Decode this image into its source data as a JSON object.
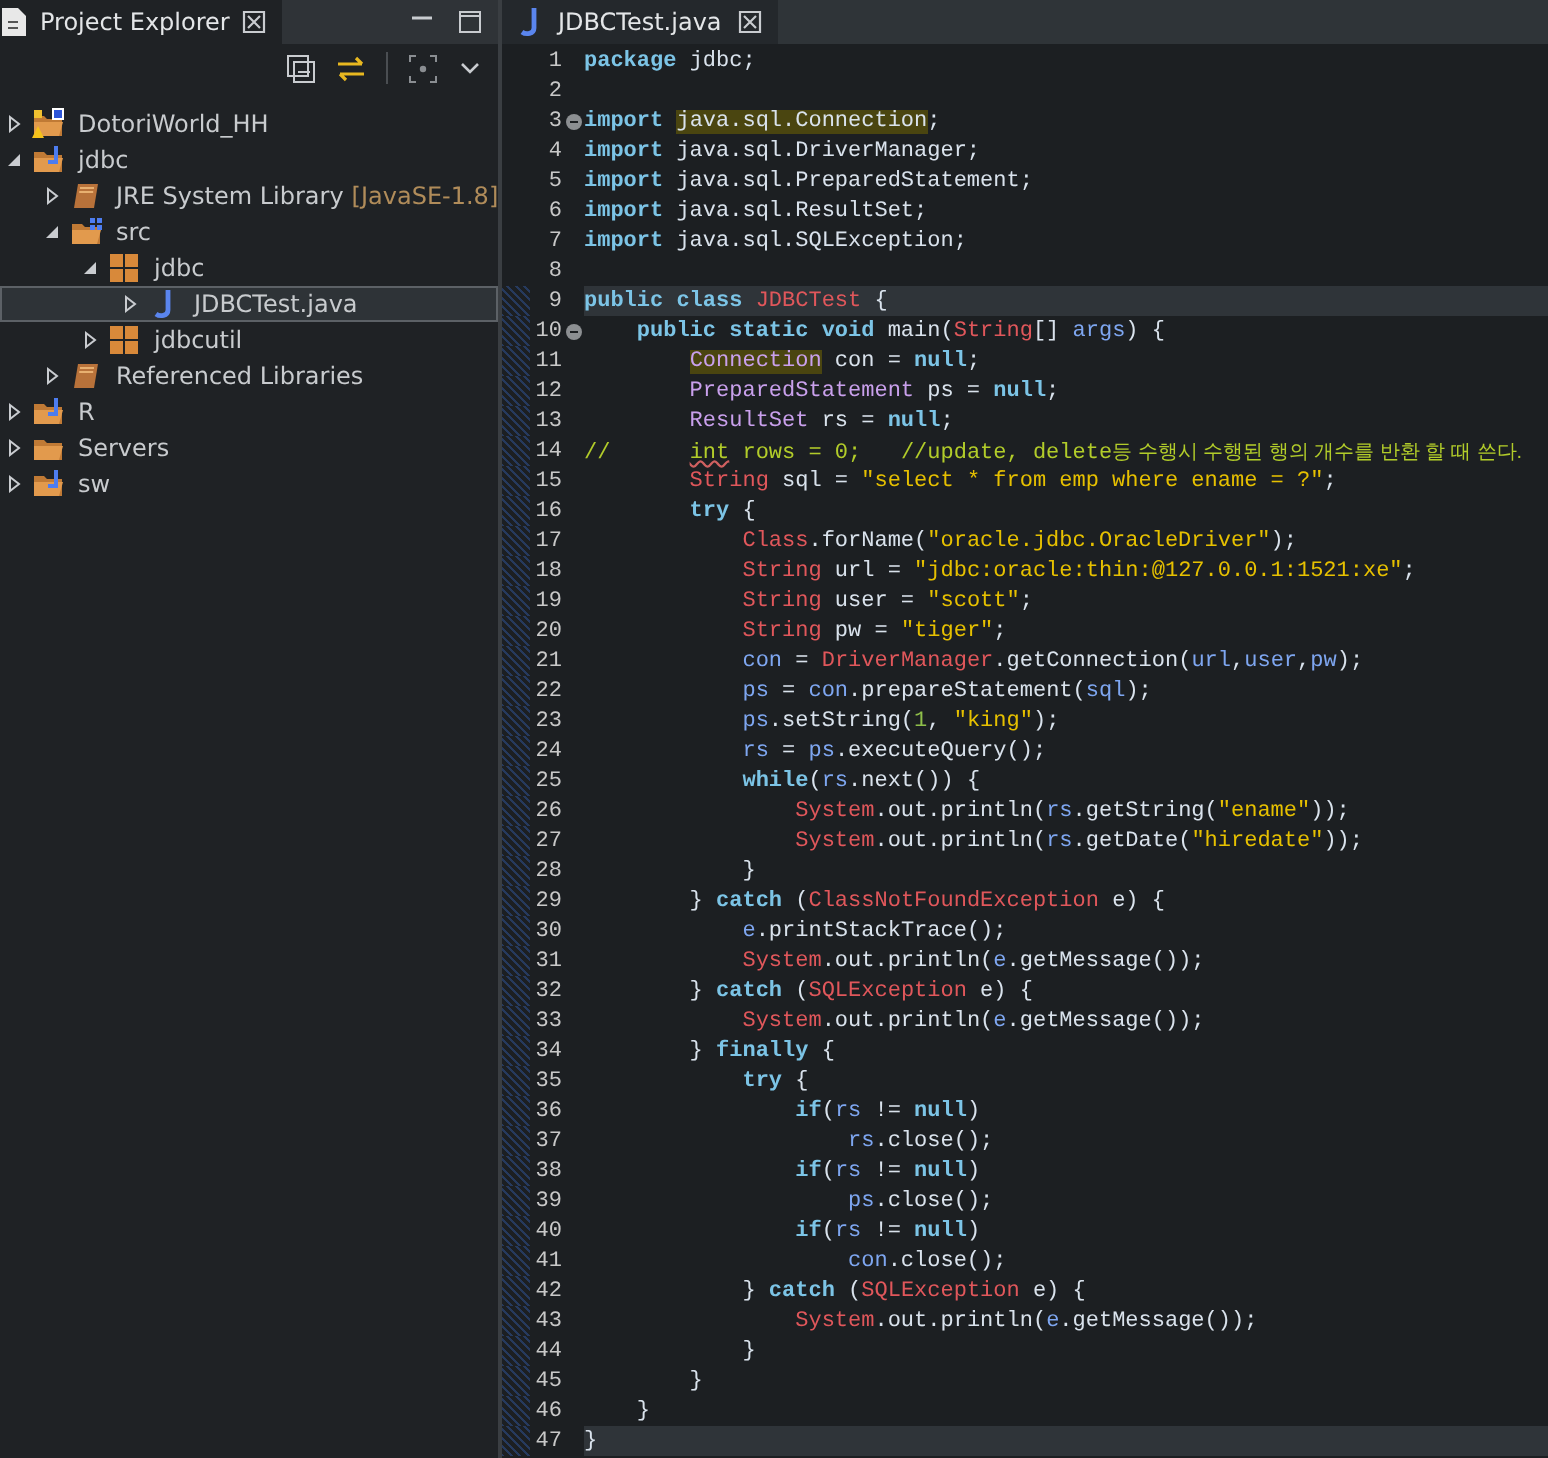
{
  "explorer": {
    "title": "Project Explorer",
    "tree": [
      {
        "label": "DotoriWorld_HH",
        "kind": "project-warning",
        "expanded": false,
        "selected": false
      },
      {
        "label": "jdbc",
        "kind": "project",
        "expanded": true,
        "selected": false,
        "children": [
          {
            "label": "JRE System Library",
            "decoration": "[JavaSE-1.8]",
            "kind": "library",
            "expanded": false,
            "selected": false
          },
          {
            "label": "src",
            "kind": "source-folder",
            "expanded": true,
            "selected": false,
            "children": [
              {
                "label": "jdbc",
                "kind": "package",
                "expanded": true,
                "selected": false,
                "children": [
                  {
                    "label": "JDBCTest.java",
                    "kind": "java-file",
                    "expanded": false,
                    "selected": true
                  }
                ]
              },
              {
                "label": "jdbcutil",
                "kind": "package",
                "expanded": false,
                "selected": false
              }
            ]
          },
          {
            "label": "Referenced Libraries",
            "kind": "library",
            "expanded": false,
            "selected": false
          }
        ]
      },
      {
        "label": "R",
        "kind": "project",
        "expanded": false,
        "selected": false
      },
      {
        "label": "Servers",
        "kind": "folder",
        "expanded": false,
        "selected": false
      },
      {
        "label": "sw",
        "kind": "project",
        "expanded": false,
        "selected": false
      }
    ]
  },
  "editor": {
    "tab": {
      "title": "JDBCTest.java"
    },
    "lines": [
      {
        "number": "1",
        "highlighted": false,
        "fold": false,
        "tokens": [
          {
            "kind": "keyword",
            "text": "package"
          },
          {
            "kind": "plain",
            "text": " jdbc;"
          }
        ]
      },
      {
        "number": "2",
        "highlighted": false,
        "fold": false
      },
      {
        "number": "3",
        "highlighted": false,
        "fold": true,
        "tokens": [
          {
            "kind": "keyword",
            "text": "import "
          },
          {
            "kind": "plain",
            "text": "java.sql.Connection",
            "occurrence": true
          },
          {
            "kind": "plain",
            "text": ";"
          }
        ]
      },
      {
        "number": "4",
        "highlighted": false,
        "fold": false,
        "tokens": [
          {
            "kind": "keyword",
            "text": "import"
          },
          {
            "kind": "plain",
            "text": " java.sql.DriverManager;"
          }
        ]
      },
      {
        "number": "5",
        "highlighted": false,
        "fold": false,
        "tokens": [
          {
            "kind": "keyword",
            "text": "import"
          },
          {
            "kind": "plain",
            "text": " java.sql.PreparedStatement;"
          }
        ]
      },
      {
        "number": "6",
        "highlighted": false,
        "fold": false,
        "tokens": [
          {
            "kind": "keyword",
            "text": "import"
          },
          {
            "kind": "plain",
            "text": " java.sql.ResultSet;"
          }
        ]
      },
      {
        "number": "7",
        "highlighted": false,
        "fold": false,
        "tokens": [
          {
            "kind": "keyword",
            "text": "import"
          },
          {
            "kind": "plain",
            "text": " java.sql.SQLException;"
          }
        ]
      },
      {
        "number": "8",
        "highlighted": false,
        "fold": false
      },
      {
        "number": "9",
        "highlighted": true,
        "fold": false,
        "tokens": [
          {
            "kind": "keyword",
            "text": "public class "
          },
          {
            "kind": "class",
            "text": "JDBCTest"
          },
          {
            "kind": "plain",
            "text": " {"
          }
        ]
      },
      {
        "number": "10",
        "highlighted": false,
        "fold": true,
        "tokens": [
          {
            "kind": "keyword",
            "text": "    public static void"
          },
          {
            "kind": "plain",
            "text": " main("
          },
          {
            "kind": "class",
            "text": "String"
          },
          {
            "kind": "plain",
            "text": "[] "
          },
          {
            "kind": "variable",
            "text": "args"
          },
          {
            "kind": "plain",
            "text": ") {"
          }
        ]
      },
      {
        "number": "11",
        "highlighted": false,
        "fold": false,
        "tokens": [
          {
            "kind": "type",
            "text": "        Connection",
            "occurrence": true
          },
          {
            "kind": "plain",
            "text": " con = "
          },
          {
            "kind": "keyword",
            "text": "null"
          },
          {
            "kind": "plain",
            "text": ";"
          }
        ]
      },
      {
        "number": "12",
        "highlighted": false,
        "fold": false,
        "tokens": [
          {
            "kind": "type",
            "text": "        PreparedStatement"
          },
          {
            "kind": "plain",
            "text": " ps = "
          },
          {
            "kind": "keyword",
            "text": "null"
          },
          {
            "kind": "plain",
            "text": ";"
          }
        ]
      },
      {
        "number": "13",
        "highlighted": false,
        "fold": false,
        "tokens": [
          {
            "kind": "type",
            "text": "        ResultSet"
          },
          {
            "kind": "plain",
            "text": " rs = "
          },
          {
            "kind": "keyword",
            "text": "null"
          },
          {
            "kind": "plain",
            "text": ";"
          }
        ]
      },
      {
        "number": "14",
        "highlighted": false,
        "fold": false,
        "tokens": [
          {
            "kind": "comment",
            "text": "//      "
          },
          {
            "kind": "comment",
            "text": "int",
            "warning": true
          },
          {
            "kind": "comment",
            "text": " rows = 0;   //update, delete"
          },
          {
            "kind": "comment",
            "text": "등 수행시 수행된 행의 개수를 반환 할 때 쓴다."
          }
        ]
      },
      {
        "number": "15",
        "highlighted": false,
        "fold": false,
        "tokens": [
          {
            "kind": "class",
            "text": "        String"
          },
          {
            "kind": "plain",
            "text": " sql = "
          },
          {
            "kind": "string",
            "text": "\"select * from emp where ename = ?\""
          },
          {
            "kind": "plain",
            "text": ";"
          }
        ]
      },
      {
        "number": "16",
        "highlighted": false,
        "fold": false,
        "tokens": [
          {
            "kind": "keyword",
            "text": "        try"
          },
          {
            "kind": "plain",
            "text": " {"
          }
        ]
      },
      {
        "number": "17",
        "highlighted": false,
        "fold": false,
        "tokens": [
          {
            "kind": "class",
            "text": "            Class"
          },
          {
            "kind": "plain",
            "text": ".forName("
          },
          {
            "kind": "string",
            "text": "\"oracle.jdbc.OracleDriver\""
          },
          {
            "kind": "plain",
            "text": ");"
          }
        ]
      },
      {
        "number": "18",
        "highlighted": false,
        "fold": false,
        "tokens": [
          {
            "kind": "class",
            "text": "            String"
          },
          {
            "kind": "plain",
            "text": " url = "
          },
          {
            "kind": "string",
            "text": "\"jdbc:oracle:thin:@127.0.0.1:1521:xe\""
          },
          {
            "kind": "plain",
            "text": ";"
          }
        ]
      },
      {
        "number": "19",
        "highlighted": false,
        "fold": false,
        "tokens": [
          {
            "kind": "class",
            "text": "            String"
          },
          {
            "kind": "plain",
            "text": " user = "
          },
          {
            "kind": "string",
            "text": "\"scott\""
          },
          {
            "kind": "plain",
            "text": ";"
          }
        ]
      },
      {
        "number": "20",
        "highlighted": false,
        "fold": false,
        "tokens": [
          {
            "kind": "class",
            "text": "            String"
          },
          {
            "kind": "plain",
            "text": " pw = "
          },
          {
            "kind": "string",
            "text": "\"tiger\""
          },
          {
            "kind": "plain",
            "text": ";"
          }
        ]
      },
      {
        "number": "21",
        "highlighted": false,
        "fold": false,
        "tokens": [
          {
            "kind": "variable",
            "text": "            con"
          },
          {
            "kind": "plain",
            "text": " = "
          },
          {
            "kind": "class",
            "text": "DriverManager"
          },
          {
            "kind": "plain",
            "text": ".getConnection("
          },
          {
            "kind": "variable",
            "text": "url"
          },
          {
            "kind": "plain",
            "text": ","
          },
          {
            "kind": "variable",
            "text": "user"
          },
          {
            "kind": "plain",
            "text": ","
          },
          {
            "kind": "variable",
            "text": "pw"
          },
          {
            "kind": "plain",
            "text": ");"
          }
        ]
      },
      {
        "number": "22",
        "highlighted": false,
        "fold": false,
        "tokens": [
          {
            "kind": "variable",
            "text": "            ps"
          },
          {
            "kind": "plain",
            "text": " = "
          },
          {
            "kind": "variable",
            "text": "con"
          },
          {
            "kind": "plain",
            "text": ".prepareStatement("
          },
          {
            "kind": "variable",
            "text": "sql"
          },
          {
            "kind": "plain",
            "text": ");"
          }
        ]
      },
      {
        "number": "23",
        "highlighted": false,
        "fold": false,
        "tokens": [
          {
            "kind": "variable",
            "text": "            ps"
          },
          {
            "kind": "plain",
            "text": ".setString("
          },
          {
            "kind": "number",
            "text": "1"
          },
          {
            "kind": "plain",
            "text": ", "
          },
          {
            "kind": "string",
            "text": "\"king\""
          },
          {
            "kind": "plain",
            "text": ");"
          }
        ]
      },
      {
        "number": "24",
        "highlighted": false,
        "fold": false,
        "tokens": [
          {
            "kind": "variable",
            "text": "            rs"
          },
          {
            "kind": "plain",
            "text": " = "
          },
          {
            "kind": "variable",
            "text": "ps"
          },
          {
            "kind": "plain",
            "text": ".executeQuery();"
          }
        ]
      },
      {
        "number": "25",
        "highlighted": false,
        "fold": false,
        "tokens": [
          {
            "kind": "keyword",
            "text": "            while"
          },
          {
            "kind": "plain",
            "text": "("
          },
          {
            "kind": "variable",
            "text": "rs"
          },
          {
            "kind": "plain",
            "text": ".next()) {"
          }
        ]
      },
      {
        "number": "26",
        "highlighted": false,
        "fold": false,
        "tokens": [
          {
            "kind": "class",
            "text": "                System"
          },
          {
            "kind": "plain",
            "text": ".out.println("
          },
          {
            "kind": "variable",
            "text": "rs"
          },
          {
            "kind": "plain",
            "text": ".getString("
          },
          {
            "kind": "string",
            "text": "\"ename\""
          },
          {
            "kind": "plain",
            "text": "));"
          }
        ]
      },
      {
        "number": "27",
        "highlighted": false,
        "fold": false,
        "tokens": [
          {
            "kind": "class",
            "text": "                System"
          },
          {
            "kind": "plain",
            "text": ".out.println("
          },
          {
            "kind": "variable",
            "text": "rs"
          },
          {
            "kind": "plain",
            "text": ".getDate("
          },
          {
            "kind": "string",
            "text": "\"hiredate\""
          },
          {
            "kind": "plain",
            "text": "));"
          }
        ]
      },
      {
        "number": "28",
        "highlighted": false,
        "fold": false,
        "tokens": [
          {
            "kind": "plain",
            "text": "            }"
          }
        ]
      },
      {
        "number": "29",
        "highlighted": false,
        "fold": false,
        "tokens": [
          {
            "kind": "plain",
            "text": "        } "
          },
          {
            "kind": "keyword",
            "text": "catch"
          },
          {
            "kind": "plain",
            "text": " ("
          },
          {
            "kind": "class",
            "text": "ClassNotFoundException"
          },
          {
            "kind": "plain",
            "text": " e) {"
          }
        ]
      },
      {
        "number": "30",
        "highlighted": false,
        "fold": false,
        "tokens": [
          {
            "kind": "variable",
            "text": "            e"
          },
          {
            "kind": "plain",
            "text": ".printStackTrace();"
          }
        ]
      },
      {
        "number": "31",
        "highlighted": false,
        "fold": false,
        "tokens": [
          {
            "kind": "class",
            "text": "            System"
          },
          {
            "kind": "plain",
            "text": ".out.println("
          },
          {
            "kind": "variable",
            "text": "e"
          },
          {
            "kind": "plain",
            "text": ".getMessage());"
          }
        ]
      },
      {
        "number": "32",
        "highlighted": false,
        "fold": false,
        "tokens": [
          {
            "kind": "plain",
            "text": "        } "
          },
          {
            "kind": "keyword",
            "text": "catch"
          },
          {
            "kind": "plain",
            "text": " ("
          },
          {
            "kind": "class",
            "text": "SQLException"
          },
          {
            "kind": "plain",
            "text": " e) {"
          }
        ]
      },
      {
        "number": "33",
        "highlighted": false,
        "fold": false,
        "tokens": [
          {
            "kind": "class",
            "text": "            System"
          },
          {
            "kind": "plain",
            "text": ".out.println("
          },
          {
            "kind": "variable",
            "text": "e"
          },
          {
            "kind": "plain",
            "text": ".getMessage());"
          }
        ]
      },
      {
        "number": "34",
        "highlighted": false,
        "fold": false,
        "tokens": [
          {
            "kind": "plain",
            "text": "        } "
          },
          {
            "kind": "keyword",
            "text": "finally"
          },
          {
            "kind": "plain",
            "text": " {"
          }
        ]
      },
      {
        "number": "35",
        "highlighted": false,
        "fold": false,
        "tokens": [
          {
            "kind": "keyword",
            "text": "            try"
          },
          {
            "kind": "plain",
            "text": " {"
          }
        ]
      },
      {
        "number": "36",
        "highlighted": false,
        "fold": false,
        "tokens": [
          {
            "kind": "keyword",
            "text": "                if"
          },
          {
            "kind": "plain",
            "text": "("
          },
          {
            "kind": "variable",
            "text": "rs"
          },
          {
            "kind": "plain",
            "text": " != "
          },
          {
            "kind": "keyword",
            "text": "null"
          },
          {
            "kind": "plain",
            "text": ")"
          }
        ]
      },
      {
        "number": "37",
        "highlighted": false,
        "fold": false,
        "tokens": [
          {
            "kind": "variable",
            "text": "                    rs"
          },
          {
            "kind": "plain",
            "text": ".close();"
          }
        ]
      },
      {
        "number": "38",
        "highlighted": false,
        "fold": false,
        "tokens": [
          {
            "kind": "keyword",
            "text": "                if"
          },
          {
            "kind": "plain",
            "text": "("
          },
          {
            "kind": "variable",
            "text": "rs"
          },
          {
            "kind": "plain",
            "text": " != "
          },
          {
            "kind": "keyword",
            "text": "null"
          },
          {
            "kind": "plain",
            "text": ")"
          }
        ]
      },
      {
        "number": "39",
        "highlighted": false,
        "fold": false,
        "tokens": [
          {
            "kind": "variable",
            "text": "                    ps"
          },
          {
            "kind": "plain",
            "text": ".close();"
          }
        ]
      },
      {
        "number": "40",
        "highlighted": false,
        "fold": false,
        "tokens": [
          {
            "kind": "keyword",
            "text": "                if"
          },
          {
            "kind": "plain",
            "text": "("
          },
          {
            "kind": "variable",
            "text": "rs"
          },
          {
            "kind": "plain",
            "text": " != "
          },
          {
            "kind": "keyword",
            "text": "null"
          },
          {
            "kind": "plain",
            "text": ")"
          }
        ]
      },
      {
        "number": "41",
        "highlighted": false,
        "fold": false,
        "tokens": [
          {
            "kind": "variable",
            "text": "                    con"
          },
          {
            "kind": "plain",
            "text": ".close();"
          }
        ]
      },
      {
        "number": "42",
        "highlighted": false,
        "fold": false,
        "tokens": [
          {
            "kind": "plain",
            "text": "            } "
          },
          {
            "kind": "keyword",
            "text": "catch"
          },
          {
            "kind": "plain",
            "text": " ("
          },
          {
            "kind": "class",
            "text": "SQLException"
          },
          {
            "kind": "plain",
            "text": " e) {"
          }
        ]
      },
      {
        "number": "43",
        "highlighted": false,
        "fold": false,
        "tokens": [
          {
            "kind": "class",
            "text": "                System"
          },
          {
            "kind": "plain",
            "text": ".out.println("
          },
          {
            "kind": "variable",
            "text": "e"
          },
          {
            "kind": "plain",
            "text": ".getMessage());"
          }
        ]
      },
      {
        "number": "44",
        "highlighted": false,
        "fold": false,
        "tokens": [
          {
            "kind": "plain",
            "text": "            }"
          }
        ]
      },
      {
        "number": "45",
        "highlighted": false,
        "fold": false,
        "tokens": [
          {
            "kind": "plain",
            "text": "        }"
          }
        ]
      },
      {
        "number": "46",
        "highlighted": false,
        "fold": false,
        "tokens": [
          {
            "kind": "plain",
            "text": "    }"
          }
        ]
      },
      {
        "number": "47",
        "highlighted": true,
        "fold": false,
        "tokens": [
          {
            "kind": "plain",
            "text": "}"
          }
        ]
      }
    ]
  }
}
